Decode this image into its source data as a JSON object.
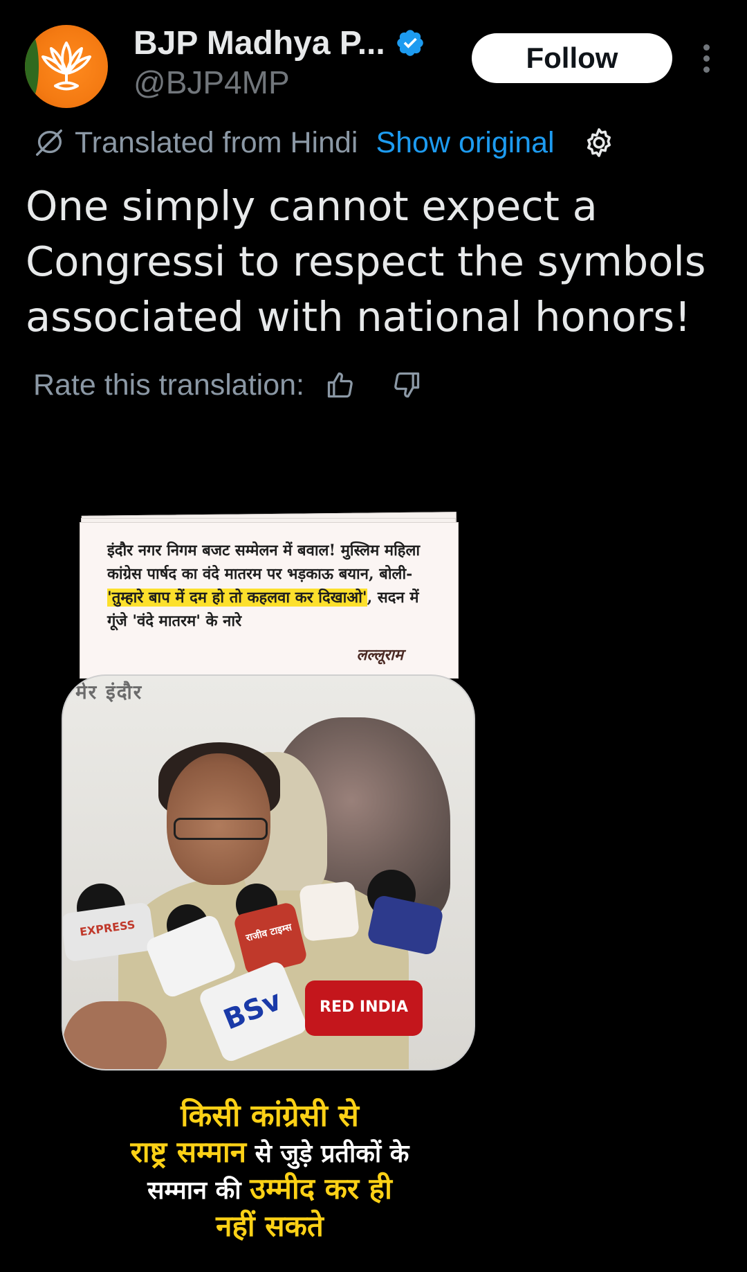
{
  "account": {
    "display_name": "BJP Madhya P...",
    "handle": "@BJP4MP",
    "follow_label": "Follow",
    "verified": true
  },
  "translation": {
    "label": "Translated from Hindi",
    "show_original": "Show original",
    "rate_label": "Rate this translation:"
  },
  "tweet": {
    "text": "One simply cannot expect a Congressi to respect the symbols associated with national honors!"
  },
  "media": {
    "headline": {
      "part1": "इंदौर नगर निगम बजट सम्मेलन में बवाल! मुस्लिम महिला कांग्रेस पार्षद का वंदे मातरम पर भड़काऊ बयान, बोली- ",
      "highlight": "'तुम्हारे बाप में दम हो तो कहलवा कर दिखाओ'",
      "part2": ", सदन में गूंजे 'वंदे मातरम' के नारे"
    },
    "source_logo": "लल्लूराम",
    "frame_mark": "मेर इंदौर",
    "mics": {
      "m1": "EXPRESS",
      "m2": "राजीव टाइम्स",
      "m3": "BSv",
      "m4": "RED INDIA"
    },
    "caption": {
      "line1": "किसी कांग्रेसी से",
      "line2_yellow": "राष्ट्र सम्मान",
      "line2_rest": " से जुड़े प्रतीकों के",
      "line3_rest": "सम्मान की ",
      "line3_yellow": "उम्मीद कर ही",
      "line4": "नहीं सकते"
    }
  },
  "colors": {
    "background": "#000000",
    "link": "#1d9bf0",
    "muted": "#71767b",
    "caption_yellow": "#fcd116"
  }
}
